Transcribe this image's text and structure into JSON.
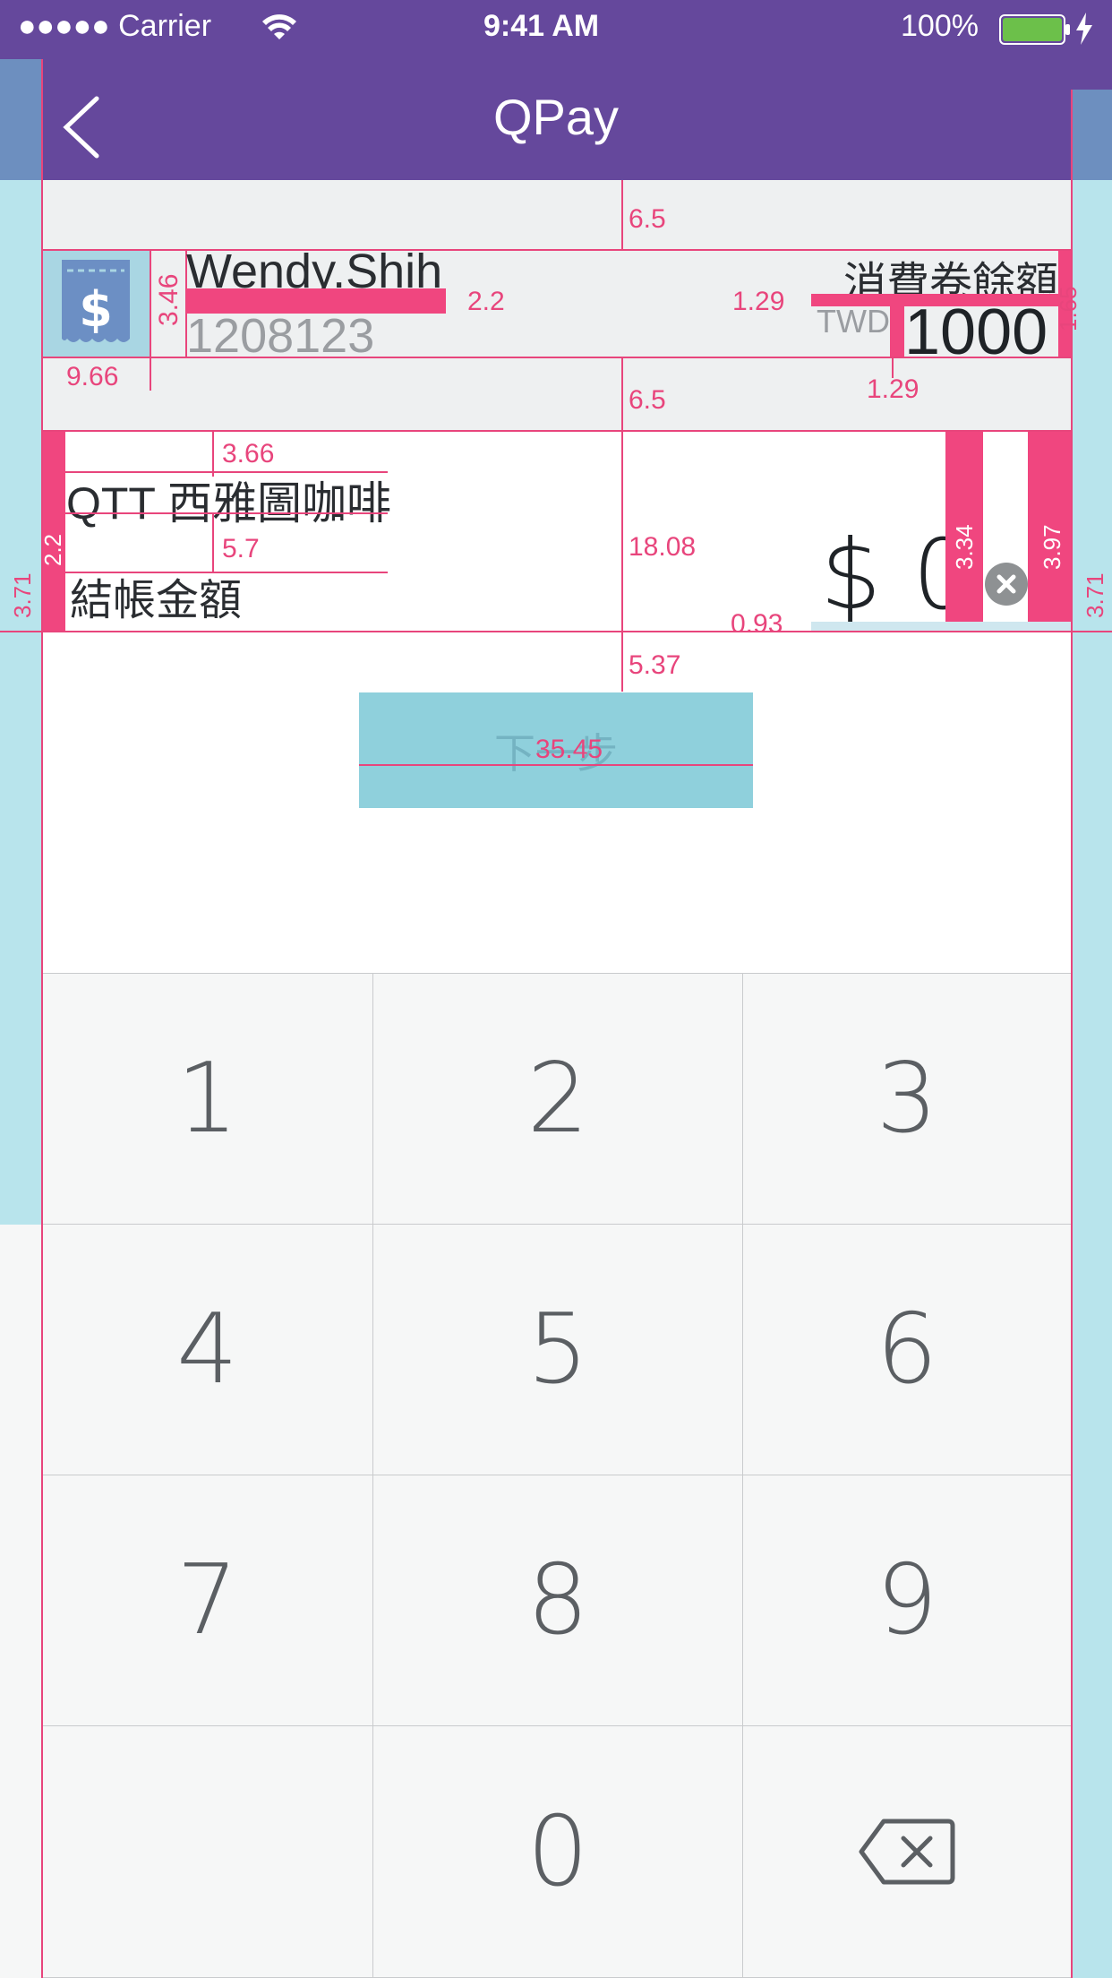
{
  "status_bar": {
    "carrier": "●●●●● Carrier",
    "time": "9:41 AM",
    "battery_percent": "100%",
    "icons": [
      "wifi-icon",
      "battery-icon",
      "charging-icon"
    ]
  },
  "nav": {
    "title": "QPay",
    "back_icon": "chevron-left-icon"
  },
  "account": {
    "icon": "voucher-dollar-icon",
    "name": "Wendy.Shih",
    "id": "1208123",
    "balance_label": "消費卷餘額",
    "currency": "TWD",
    "balance": "1000"
  },
  "merchant": {
    "name": "QTT 西雅圖咖啡",
    "amount_label": "結帳金額",
    "amount": "$ 0",
    "clear_icon": "clear-circle-icon"
  },
  "next_button": {
    "label": "下一步"
  },
  "keypad": {
    "keys": [
      "1",
      "2",
      "3",
      "4",
      "5",
      "6",
      "7",
      "8",
      "9",
      "",
      "0",
      ""
    ],
    "backspace_icon": "backspace-icon"
  },
  "annotations": {
    "top_gap": "6.5",
    "icon_height": "3.46",
    "name_gap": "2.2",
    "left_gap": "9.66",
    "balance_gap_top": "1.29",
    "balance_gap_bottom": "1.29",
    "balance_right": "1.65",
    "mid_gap": "6.5",
    "merchant_top": "3.66",
    "merchant_gap": "5.7",
    "row_left": "2.2",
    "row_height": "18.08",
    "amount_h": "3.34",
    "amount_right": "3.97",
    "amount_bottom": "0.93",
    "side_left": "3.71",
    "side_right": "3.71",
    "button_gap": "5.37",
    "button_width": "35.45"
  },
  "colors": {
    "nav_bg": "#65489c",
    "annotation": "#e8457c",
    "button_bg": "#8fd0dc",
    "keypad_bg": "#f6f7f7"
  }
}
